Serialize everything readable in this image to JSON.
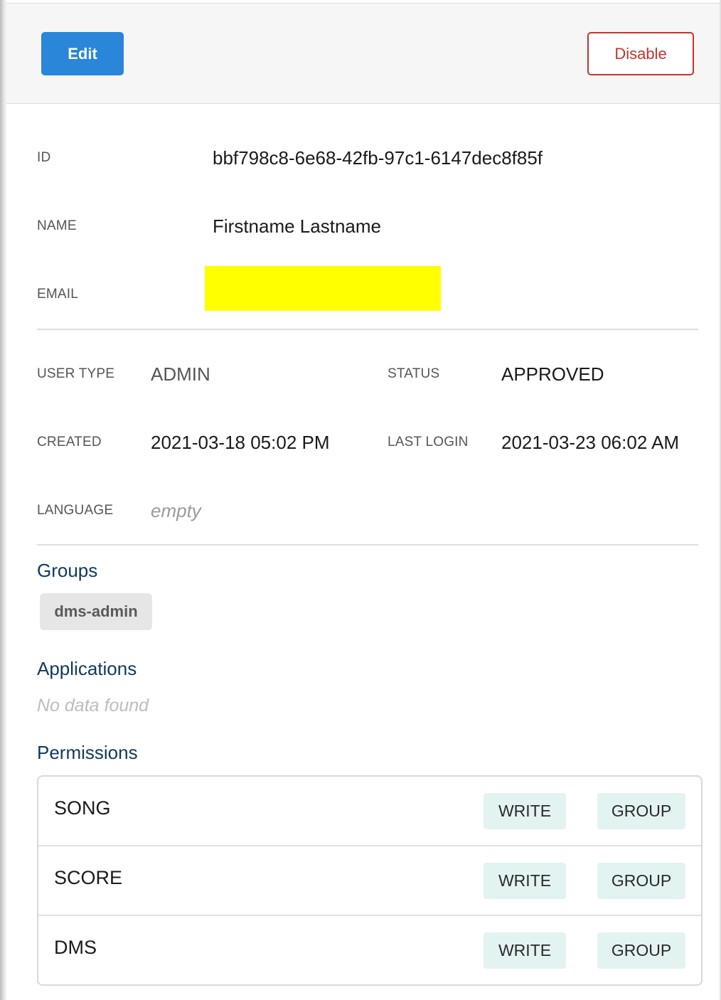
{
  "toolbar": {
    "edit_label": "Edit",
    "disable_label": "Disable"
  },
  "details": {
    "id": {
      "label": "ID",
      "value": "bbf798c8-6e68-42fb-97c1-6147dec8f85f"
    },
    "name": {
      "label": "NAME",
      "value": "Firstname Lastname"
    },
    "email": {
      "label": "EMAIL"
    },
    "user_type": {
      "label": "USER TYPE",
      "value": "ADMIN"
    },
    "status": {
      "label": "STATUS",
      "value": "APPROVED"
    },
    "created": {
      "label": "CREATED",
      "value": "2021-03-18 05:02 PM"
    },
    "last_login": {
      "label": "LAST LOGIN",
      "value": "2021-03-23 06:02 AM"
    },
    "language": {
      "label": "LANGUAGE",
      "value": "empty"
    }
  },
  "groups": {
    "heading": "Groups",
    "items": [
      "dms-admin"
    ]
  },
  "applications": {
    "heading": "Applications",
    "empty_text": "No data found"
  },
  "permissions": {
    "heading": "Permissions",
    "rows": [
      {
        "name": "SONG",
        "access": "WRITE",
        "scope": "GROUP"
      },
      {
        "name": "SCORE",
        "access": "WRITE",
        "scope": "GROUP"
      },
      {
        "name": "DMS",
        "access": "WRITE",
        "scope": "GROUP"
      }
    ]
  },
  "colors": {
    "primary": "#2a86d9",
    "danger": "#c8322f",
    "heading": "#0f3a5c",
    "tag_bg": "#e3f3f1",
    "redaction": "#ffff00"
  }
}
